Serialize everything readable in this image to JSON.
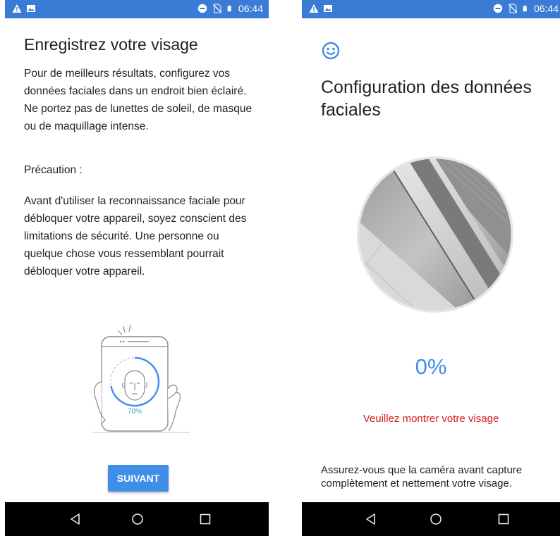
{
  "left_screen": {
    "status": {
      "time": "06:44"
    },
    "title": "Enregistrez votre visage",
    "intro": "Pour de meilleurs résultats, configurez vos données faciales dans un endroit bien éclairé. Ne portez pas de lunettes de soleil, de masque ou de maquillage intense.",
    "caution_label": "Précaution :",
    "caution_text": "Avant d'utiliser la reconnaissance faciale pour débloquer votre appareil, soyez conscient des limitations de sécurité. Une personne ou quelque chose vous ressemblant pourrait débloquer votre appareil.",
    "illustration_percent": "70%",
    "next_button": "SUIVANT"
  },
  "right_screen": {
    "status": {
      "time": "06:44"
    },
    "title": "Configuration des données faciales",
    "progress_text": "0%",
    "progress_value": 0,
    "warning": "Veuillez montrer votre visage",
    "hint": "Assurez-vous que la caméra avant capture complètement et nettement votre visage."
  },
  "colors": {
    "status_bar": "#3a7bd5",
    "accent": "#3f8ee8",
    "warning": "#d71b1b",
    "nav_bar": "#000000"
  },
  "icons": {
    "status_left": [
      "warning-icon",
      "image-icon"
    ],
    "status_right": [
      "do-not-disturb-icon",
      "no-sim-icon",
      "battery-icon"
    ],
    "nav": [
      "back-icon",
      "home-icon",
      "recents-icon"
    ],
    "header": "smiley-face-icon"
  }
}
